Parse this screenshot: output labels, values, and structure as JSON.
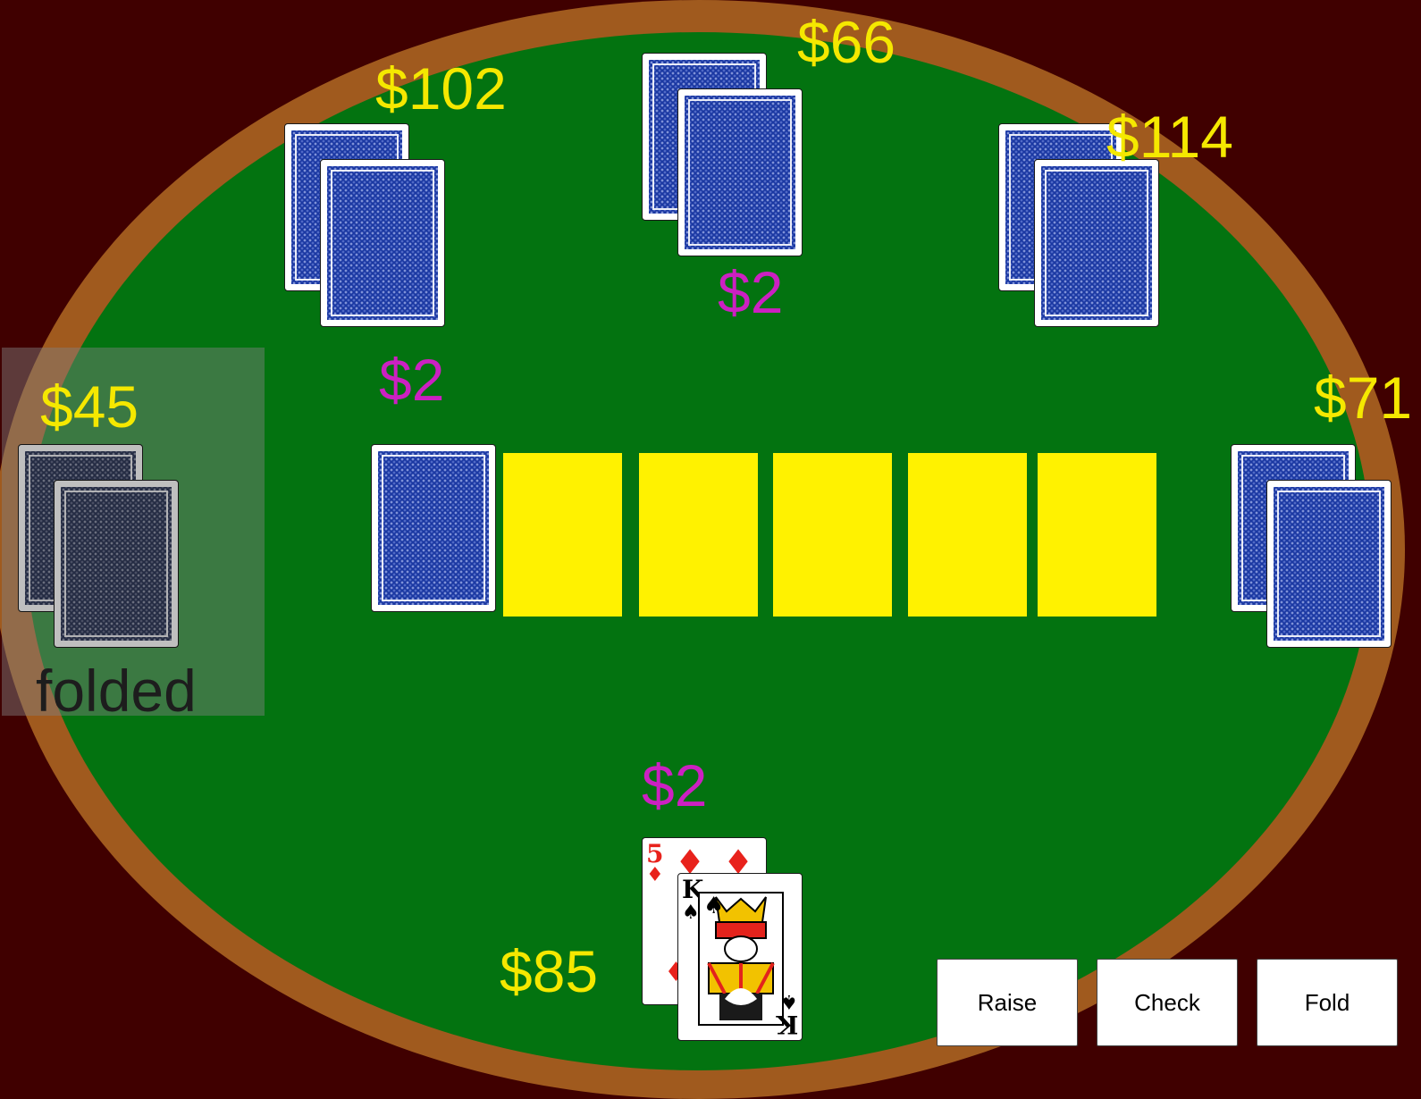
{
  "colors": {
    "background": "#400000",
    "rail": "#a05a1e",
    "felt": "#037310",
    "stack_text": "#f5e800",
    "bet_text": "#cc20c2",
    "board_slot": "#fff200",
    "card_back": "#1a38a2"
  },
  "players": [
    {
      "seat": "left",
      "stack": "$45",
      "status": "folded"
    },
    {
      "seat": "top-left",
      "stack": "$102",
      "bet": "$2"
    },
    {
      "seat": "top-center",
      "stack": "$66",
      "bet": "$2"
    },
    {
      "seat": "top-right",
      "stack": "$114"
    },
    {
      "seat": "right",
      "stack": "$71"
    },
    {
      "seat": "bottom",
      "stack": "$85",
      "bet": "$2",
      "hand": [
        {
          "rank": "5",
          "suit": "diamonds",
          "suit_symbol": "♦"
        },
        {
          "rank": "K",
          "suit": "spades",
          "suit_symbol": "♠"
        }
      ]
    }
  ],
  "board": {
    "deck_card": "card-back",
    "empty_slots": 5
  },
  "actions": {
    "raise": "Raise",
    "check": "Check",
    "fold": "Fold"
  }
}
